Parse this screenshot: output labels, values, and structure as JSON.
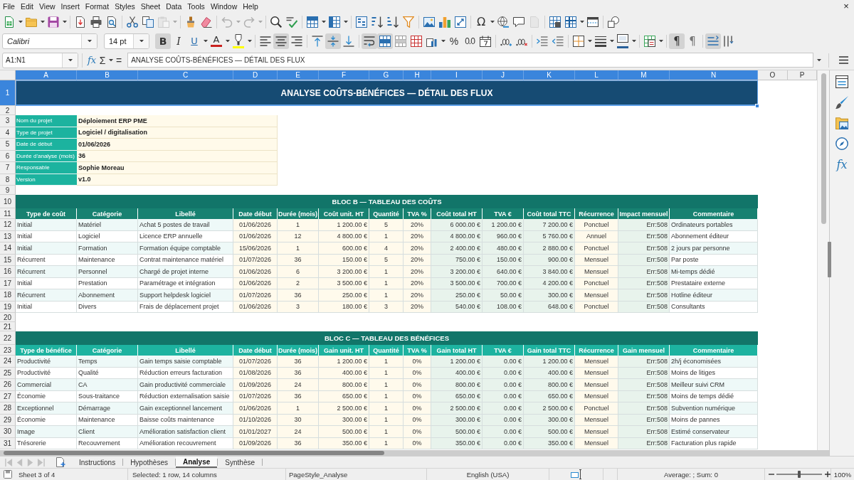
{
  "menu_bar": {
    "items": [
      "File",
      "Edit",
      "View",
      "Insert",
      "Format",
      "Styles",
      "Sheet",
      "Data",
      "Tools",
      "Window",
      "Help"
    ],
    "close": "×"
  },
  "standard_toolbar": [
    [
      {
        "kind": "new",
        "dropdown": true,
        "disabled": false
      },
      {
        "kind": "open",
        "dropdown": true,
        "disabled": false
      },
      {
        "kind": "save",
        "dropdown": true,
        "disabled": false
      }
    ],
    [
      {
        "kind": "pdf",
        "disabled": false
      },
      {
        "kind": "print",
        "disabled": false
      },
      {
        "kind": "preview",
        "disabled": false
      }
    ],
    [
      {
        "kind": "cut",
        "disabled": false
      },
      {
        "kind": "copy",
        "disabled": false
      },
      {
        "kind": "paste",
        "dropdown": true,
        "disabled": true
      }
    ],
    [
      {
        "kind": "clone",
        "disabled": false
      },
      {
        "kind": "clear",
        "disabled": false
      }
    ],
    [
      {
        "kind": "undo",
        "dropdown": true,
        "disabled": true
      },
      {
        "kind": "redo",
        "dropdown": true,
        "disabled": true
      }
    ],
    [
      {
        "kind": "find",
        "disabled": false
      },
      {
        "kind": "spelling",
        "disabled": false
      }
    ],
    [
      {
        "kind": "rows",
        "dropdown": true,
        "disabled": false
      },
      {
        "kind": "columns",
        "dropdown": true,
        "disabled": false
      }
    ],
    [
      {
        "kind": "sort",
        "disabled": false
      },
      {
        "kind": "ascending",
        "disabled": false
      },
      {
        "kind": "descending",
        "disabled": false
      },
      {
        "kind": "filter",
        "disabled": false
      }
    ],
    [
      {
        "kind": "image",
        "disabled": false
      },
      {
        "kind": "chart",
        "disabled": false
      },
      {
        "kind": "pivot",
        "disabled": false
      }
    ],
    [
      {
        "kind": "symbol",
        "glyph": "Ω",
        "dropdown": true,
        "disabled": false
      },
      {
        "kind": "hyperlink",
        "disabled": false
      },
      {
        "kind": "comment",
        "disabled": false
      },
      {
        "kind": "headers",
        "disabled": true
      }
    ],
    [
      {
        "kind": "printarea",
        "disabled": false
      },
      {
        "kind": "freeze",
        "dropdown": true,
        "disabled": false
      },
      {
        "kind": "split",
        "disabled": false
      }
    ],
    [
      {
        "kind": "shapes",
        "disabled": false
      }
    ]
  ],
  "formatting_toolbar": {
    "font_name": "Calibri",
    "font_size": "14 pt",
    "groups": [
      [
        {
          "kind": "bold",
          "glyph": "B",
          "pressed": true
        },
        {
          "kind": "italic",
          "glyph": "I",
          "pressed": false
        },
        {
          "kind": "underline",
          "glyph": "U",
          "dropdown": true,
          "pressed": false
        },
        {
          "kind": "fontcolor",
          "glyph": "A",
          "color": "#c9211e",
          "dropdown": true,
          "pressed": false
        },
        {
          "kind": "highlight",
          "color": "#ffff00",
          "dropdown": true,
          "pressed": false
        }
      ],
      [
        {
          "kind": "left",
          "pressed": false
        },
        {
          "kind": "center",
          "pressed": true
        },
        {
          "kind": "right",
          "pressed": false
        }
      ],
      [
        {
          "kind": "top",
          "pressed": false
        },
        {
          "kind": "middle",
          "pressed": true
        },
        {
          "kind": "bottom",
          "pressed": false
        }
      ],
      [
        {
          "kind": "wrap",
          "pressed": true
        },
        {
          "kind": "mergecenter",
          "pressed": true
        },
        {
          "kind": "merge",
          "pressed": false
        },
        {
          "kind": "unmerge",
          "pressed": false
        },
        {
          "kind": "currency",
          "dropdown": true,
          "pressed": false
        },
        {
          "kind": "percent",
          "glyph": "%",
          "pressed": false
        },
        {
          "kind": "number",
          "glyph": "0.0",
          "pressed": false
        },
        {
          "kind": "date",
          "pressed": false
        }
      ],
      [
        {
          "kind": "adddecimal",
          "pressed": false
        },
        {
          "kind": "deletedecimal",
          "pressed": false
        }
      ],
      [
        {
          "kind": "indent",
          "pressed": false
        },
        {
          "kind": "outdent",
          "pressed": false
        }
      ],
      [
        {
          "kind": "borders",
          "dropdown": true,
          "pressed": false
        },
        {
          "kind": "borderstyle",
          "dropdown": true,
          "pressed": false
        },
        {
          "kind": "bordercolor",
          "color": "#2a6099",
          "dropdown": true,
          "pressed": false
        }
      ],
      [
        {
          "kind": "conditional",
          "dropdown": true,
          "pressed": false
        }
      ],
      [
        {
          "kind": "ltr",
          "glyph": "¶",
          "pressed": true
        },
        {
          "kind": "rtl",
          "glyph": "¶",
          "pressed": false
        }
      ],
      [
        {
          "kind": "stacked",
          "pressed": true
        },
        {
          "kind": "vertical",
          "pressed": false
        }
      ]
    ]
  },
  "formula_bar": {
    "name_box": "A1:N1",
    "wizard": "fx",
    "sum": "Σ",
    "equals": "=",
    "content": "ANALYSE COÛTS-BÉNÉFICES — DÉTAIL DES FLUX"
  },
  "sheet": {
    "columns": [
      {
        "label": "A",
        "selected": true
      },
      {
        "label": "B",
        "selected": true
      },
      {
        "label": "C",
        "selected": true
      },
      {
        "label": "D",
        "selected": true
      },
      {
        "label": "E",
        "selected": true
      },
      {
        "label": "F",
        "selected": true
      },
      {
        "label": "G",
        "selected": true
      },
      {
        "label": "H",
        "selected": true
      },
      {
        "label": "I",
        "selected": true
      },
      {
        "label": "J",
        "selected": true
      },
      {
        "label": "K",
        "selected": true
      },
      {
        "label": "L",
        "selected": true
      },
      {
        "label": "M",
        "selected": true
      },
      {
        "label": "N",
        "selected": true
      },
      {
        "label": "O",
        "selected": false
      },
      {
        "label": "P",
        "selected": false
      }
    ],
    "rows": [
      {
        "number": "1",
        "kind": "title",
        "selected": true,
        "text": "ANALYSE COÛTS-BÉNÉFICES — DÉTAIL DES FLUX"
      },
      {
        "number": "2",
        "kind": "blank",
        "selected": false
      },
      {
        "number": "3",
        "kind": "info",
        "selected": false,
        "label": "Nom du projet",
        "value": "Déploiement ERP PME"
      },
      {
        "number": "4",
        "kind": "info",
        "selected": false,
        "label": "Type de projet",
        "value": "Logiciel / digitalisation"
      },
      {
        "number": "5",
        "kind": "info",
        "selected": false,
        "label": "Date de début",
        "value": "01/06/2026"
      },
      {
        "number": "6",
        "kind": "info",
        "selected": false,
        "label": "Durée d'analyse (mois)",
        "value": "36"
      },
      {
        "number": "7",
        "kind": "info",
        "selected": false,
        "label": "Responsable",
        "value": "Sophie Moreau"
      },
      {
        "number": "8",
        "kind": "info",
        "selected": false,
        "label": "Version",
        "value": "v1.0"
      },
      {
        "number": "9",
        "kind": "blank",
        "selected": false
      },
      {
        "number": "10",
        "kind": "section",
        "selected": false,
        "text": "BLOC B — TABLEAU DES COÛTS"
      },
      {
        "number": "11",
        "kind": "header",
        "selected": false,
        "color": "#178171",
        "cells": [
          {
            "text": "Type de coût",
            "kind": "text"
          },
          {
            "text": "Catégorie",
            "kind": "text"
          },
          {
            "text": "Libellé",
            "kind": "text"
          },
          {
            "text": "Date début",
            "kind": "entry"
          },
          {
            "text": "Durée (mois)",
            "kind": "entry"
          },
          {
            "text": "Coût unit. HT",
            "kind": "amount"
          },
          {
            "text": "Quantité",
            "kind": "entry"
          },
          {
            "text": "TVA %",
            "kind": "entry"
          },
          {
            "text": "Coût total HT",
            "kind": "calc"
          },
          {
            "text": "TVA €",
            "kind": "calc"
          },
          {
            "text": "Coût total TTC",
            "kind": "calc"
          },
          {
            "text": "Récurrence",
            "kind": "entry"
          },
          {
            "text": "Impact mensuel",
            "kind": "calc"
          },
          {
            "text": "Commentaire",
            "kind": "text"
          }
        ]
      },
      {
        "number": "12",
        "kind": "data",
        "selected": false,
        "cells": [
          "Initial",
          "Matériel",
          "Achat 5 postes de travail",
          "01/06/2026",
          "1",
          "1 200.00 €",
          "5",
          "20%",
          "6 000.00 €",
          "1 200.00 €",
          "7 200.00 €",
          "Ponctuel",
          "Err:508",
          "Ordinateurs portables"
        ]
      },
      {
        "number": "13",
        "kind": "data",
        "selected": false,
        "cells": [
          "Initial",
          "Logiciel",
          "Licence ERP annuelle",
          "01/06/2026",
          "12",
          "4 800.00 €",
          "1",
          "20%",
          "4 800.00 €",
          "960.00 €",
          "5 760.00 €",
          "Annuel",
          "Err:508",
          "Abonnement éditeur"
        ]
      },
      {
        "number": "14",
        "kind": "data",
        "selected": false,
        "cells": [
          "Initial",
          "Formation",
          "Formation équipe comptable",
          "15/06/2026",
          "1",
          "600.00 €",
          "4",
          "20%",
          "2 400.00 €",
          "480.00 €",
          "2 880.00 €",
          "Ponctuel",
          "Err:508",
          "2 jours par personne"
        ]
      },
      {
        "number": "15",
        "kind": "data",
        "selected": false,
        "cells": [
          "Récurrent",
          "Maintenance",
          "Contrat maintenance matériel",
          "01/07/2026",
          "36",
          "150.00 €",
          "5",
          "20%",
          "750.00 €",
          "150.00 €",
          "900.00 €",
          "Mensuel",
          "Err:508",
          "Par poste"
        ]
      },
      {
        "number": "16",
        "kind": "data",
        "selected": false,
        "cells": [
          "Récurrent",
          "Personnel",
          "Chargé de projet interne",
          "01/06/2026",
          "6",
          "3 200.00 €",
          "1",
          "20%",
          "3 200.00 €",
          "640.00 €",
          "3 840.00 €",
          "Mensuel",
          "Err:508",
          "Mi-temps dédié"
        ]
      },
      {
        "number": "17",
        "kind": "data",
        "selected": false,
        "cells": [
          "Initial",
          "Prestation",
          "Paramétrage et intégration",
          "01/06/2026",
          "2",
          "3 500.00 €",
          "1",
          "20%",
          "3 500.00 €",
          "700.00 €",
          "4 200.00 €",
          "Ponctuel",
          "Err:508",
          "Prestataire externe"
        ]
      },
      {
        "number": "18",
        "kind": "data",
        "selected": false,
        "cells": [
          "Récurrent",
          "Abonnement",
          "Support helpdesk logiciel",
          "01/07/2026",
          "36",
          "250.00 €",
          "1",
          "20%",
          "250.00 €",
          "50.00 €",
          "300.00 €",
          "Mensuel",
          "Err:508",
          "Hotline éditeur"
        ]
      },
      {
        "number": "19",
        "kind": "data",
        "selected": false,
        "cells": [
          "Initial",
          "Divers",
          "Frais de déplacement projet",
          "01/06/2026",
          "3",
          "180.00 €",
          "3",
          "20%",
          "540.00 €",
          "108.00 €",
          "648.00 €",
          "Ponctuel",
          "Err:508",
          "Consultants"
        ]
      },
      {
        "number": "20",
        "kind": "blank",
        "selected": false
      },
      {
        "number": "21",
        "kind": "blank",
        "selected": false
      },
      {
        "number": "22",
        "kind": "section",
        "selected": false,
        "text": "BLOC C — TABLEAU DES BÉNÉFICES"
      },
      {
        "number": "23",
        "kind": "header",
        "selected": false,
        "color": "#1db3a0",
        "cells": [
          {
            "text": "Type de bénéfice",
            "kind": "text"
          },
          {
            "text": "Catégorie",
            "kind": "text"
          },
          {
            "text": "Libellé",
            "kind": "text"
          },
          {
            "text": "Date début",
            "kind": "entry"
          },
          {
            "text": "Durée (mois)",
            "kind": "entry"
          },
          {
            "text": "Gain unit. HT",
            "kind": "amount"
          },
          {
            "text": "Quantité",
            "kind": "entry"
          },
          {
            "text": "TVA %",
            "kind": "entry"
          },
          {
            "text": "Gain total HT",
            "kind": "calc"
          },
          {
            "text": "TVA €",
            "kind": "calc"
          },
          {
            "text": "Gain total TTC",
            "kind": "calc"
          },
          {
            "text": "Récurrence",
            "kind": "entry"
          },
          {
            "text": "Gain mensuel",
            "kind": "calc"
          },
          {
            "text": "Commentaire",
            "kind": "text"
          }
        ]
      },
      {
        "number": "24",
        "kind": "data",
        "selected": false,
        "cells": [
          "Productivité",
          "Temps",
          "Gain temps saisie comptable",
          "01/07/2026",
          "36",
          "1 200.00 €",
          "1",
          "0%",
          "1 200.00 €",
          "0.00 €",
          "1 200.00 €",
          "Mensuel",
          "Err:508",
          "2h/j économisées"
        ]
      },
      {
        "number": "25",
        "kind": "data",
        "selected": false,
        "cells": [
          "Productivité",
          "Qualité",
          "Réduction erreurs facturation",
          "01/08/2026",
          "36",
          "400.00 €",
          "1",
          "0%",
          "400.00 €",
          "0.00 €",
          "400.00 €",
          "Mensuel",
          "Err:508",
          "Moins de litiges"
        ]
      },
      {
        "number": "26",
        "kind": "data",
        "selected": false,
        "cells": [
          "Commercial",
          "CA",
          "Gain productivité commerciale",
          "01/09/2026",
          "24",
          "800.00 €",
          "1",
          "0%",
          "800.00 €",
          "0.00 €",
          "800.00 €",
          "Mensuel",
          "Err:508",
          "Meilleur suivi CRM"
        ]
      },
      {
        "number": "27",
        "kind": "data",
        "selected": false,
        "cells": [
          "Économie",
          "Sous-traitance",
          "Réduction externalisation saisie",
          "01/07/2026",
          "36",
          "650.00 €",
          "1",
          "0%",
          "650.00 €",
          "0.00 €",
          "650.00 €",
          "Mensuel",
          "Err:508",
          "Moins de temps dédié"
        ]
      },
      {
        "number": "28",
        "kind": "data",
        "selected": false,
        "cells": [
          "Exceptionnel",
          "Démarrage",
          "Gain exceptionnel lancement",
          "01/06/2026",
          "1",
          "2 500.00 €",
          "1",
          "0%",
          "2 500.00 €",
          "0.00 €",
          "2 500.00 €",
          "Ponctuel",
          "Err:508",
          "Subvention numérique"
        ]
      },
      {
        "number": "29",
        "kind": "data",
        "selected": false,
        "cells": [
          "Économie",
          "Maintenance",
          "Baisse coûts maintenance",
          "01/10/2026",
          "30",
          "300.00 €",
          "1",
          "0%",
          "300.00 €",
          "0.00 €",
          "300.00 €",
          "Mensuel",
          "Err:508",
          "Moins de pannes"
        ]
      },
      {
        "number": "30",
        "kind": "data",
        "selected": false,
        "cells": [
          "Image",
          "Client",
          "Amélioration satisfaction client",
          "01/01/2027",
          "24",
          "500.00 €",
          "1",
          "0%",
          "500.00 €",
          "0.00 €",
          "500.00 €",
          "Mensuel",
          "Err:508",
          "Estimé conservateur"
        ]
      },
      {
        "number": "31",
        "kind": "data",
        "selected": false,
        "cells": [
          "Trésorerie",
          "Recouvrement",
          "Amélioration recouvrement",
          "01/09/2026",
          "36",
          "350.00 €",
          "1",
          "0%",
          "350.00 €",
          "0.00 €",
          "350.00 €",
          "Mensuel",
          "Err:508",
          "Facturation plus rapide"
        ]
      }
    ]
  },
  "sidebar": [
    {
      "kind": "properties"
    },
    {
      "kind": "styles"
    },
    {
      "kind": "gallery"
    },
    {
      "kind": "navigator"
    },
    {
      "kind": "functions",
      "glyph": "fx"
    }
  ],
  "sheet_tabs": {
    "navigation": [
      {
        "kind": "first",
        "disabled": true
      },
      {
        "kind": "previous",
        "disabled": true
      },
      {
        "kind": "next",
        "disabled": true
      },
      {
        "kind": "last",
        "disabled": true
      }
    ],
    "tabs": [
      {
        "label": "Instructions",
        "selected": false
      },
      {
        "label": "Hypothèses",
        "selected": false
      },
      {
        "label": "Analyse",
        "selected": true
      },
      {
        "label": "Synthèse",
        "selected": false
      }
    ]
  },
  "status_bar": {
    "sheet": "Sheet 3 of 4",
    "selection": "Selected: 1 row, 14 columns",
    "page_style": "PageStyle_Analyse",
    "language": "English (USA)",
    "summary": "Average: ; Sum: 0",
    "zoom": {
      "level": 0.5,
      "reading": "100%"
    }
  }
}
